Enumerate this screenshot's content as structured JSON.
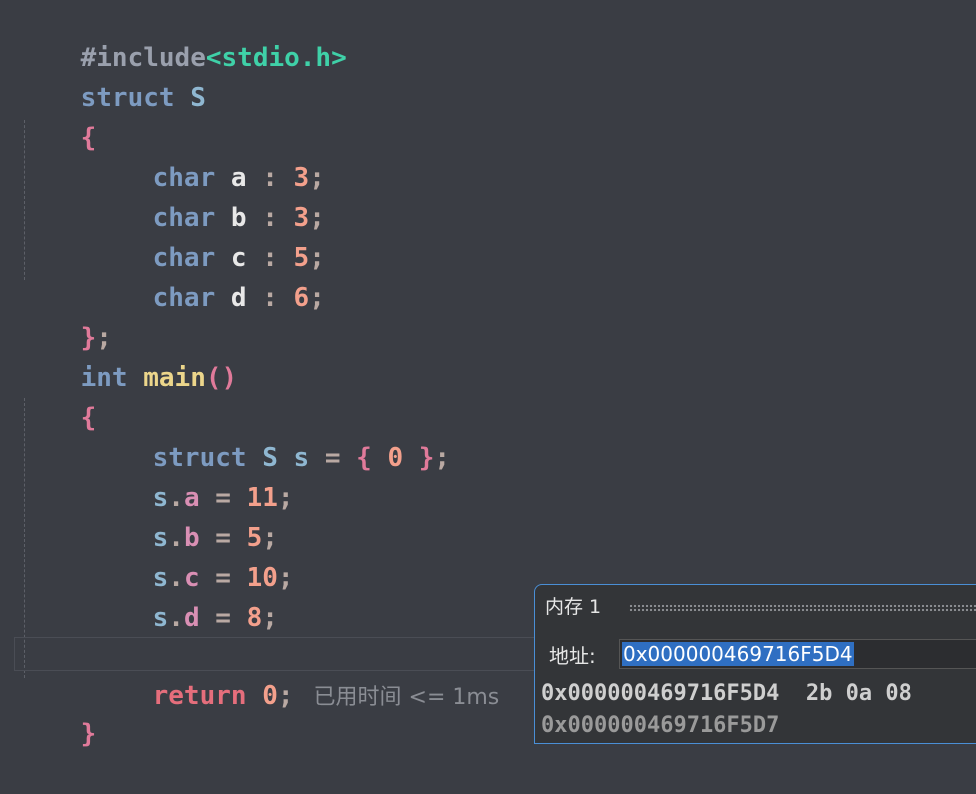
{
  "code": {
    "l1": {
      "directive": "#include",
      "header": "<stdio.h>"
    },
    "l2": {
      "keyword": "struct",
      "name": "S"
    },
    "l3": {
      "brace": "{"
    },
    "fields": [
      {
        "type": "char",
        "name": "a",
        "colon": ":",
        "bits": "3",
        "semi": ";"
      },
      {
        "type": "char",
        "name": "b",
        "colon": ":",
        "bits": "3",
        "semi": ";"
      },
      {
        "type": "char",
        "name": "c",
        "colon": ":",
        "bits": "5",
        "semi": ";"
      },
      {
        "type": "char",
        "name": "d",
        "colon": ":",
        "bits": "6",
        "semi": ";"
      }
    ],
    "l8": {
      "close": "}",
      "semi": ";"
    },
    "l9": {
      "type": "int",
      "fn": "main",
      "parens": "()"
    },
    "l10": {
      "brace": "{"
    },
    "l11": {
      "kw": "struct",
      "type": "S",
      "var": "s",
      "eq": "=",
      "open": "{",
      "zero": "0",
      "close": "}",
      "semi": ";"
    },
    "assigns": [
      {
        "obj": "s",
        "dot": ".",
        "field": "a",
        "eq": "=",
        "value": "11",
        "semi": ";"
      },
      {
        "obj": "s",
        "dot": ".",
        "field": "b",
        "eq": "=",
        "value": "5",
        "semi": ";"
      },
      {
        "obj": "s",
        "dot": ".",
        "field": "c",
        "eq": "=",
        "value": "10",
        "semi": ";"
      },
      {
        "obj": "s",
        "dot": ".",
        "field": "d",
        "eq": "=",
        "value": "8",
        "semi": ";"
      }
    ],
    "l17": {
      "kw": "return",
      "value": "0",
      "semi": ";",
      "inlay": "已用时间 <= 1ms"
    },
    "l18": {
      "brace": "}"
    }
  },
  "memory": {
    "title": "内存 1",
    "address_label": "地址:",
    "address_value": "0x000000469716F5D4",
    "row1": "0x000000469716F5D4  2b 0a 08",
    "row2": "0x000000469716F5D7"
  },
  "colors": {
    "background": "#3a3d44",
    "keyword": "#7d9bc1",
    "number": "#f3a08c",
    "function": "#ecd68b",
    "string": "#3fd1a8",
    "selection": "#2f6fc2"
  }
}
